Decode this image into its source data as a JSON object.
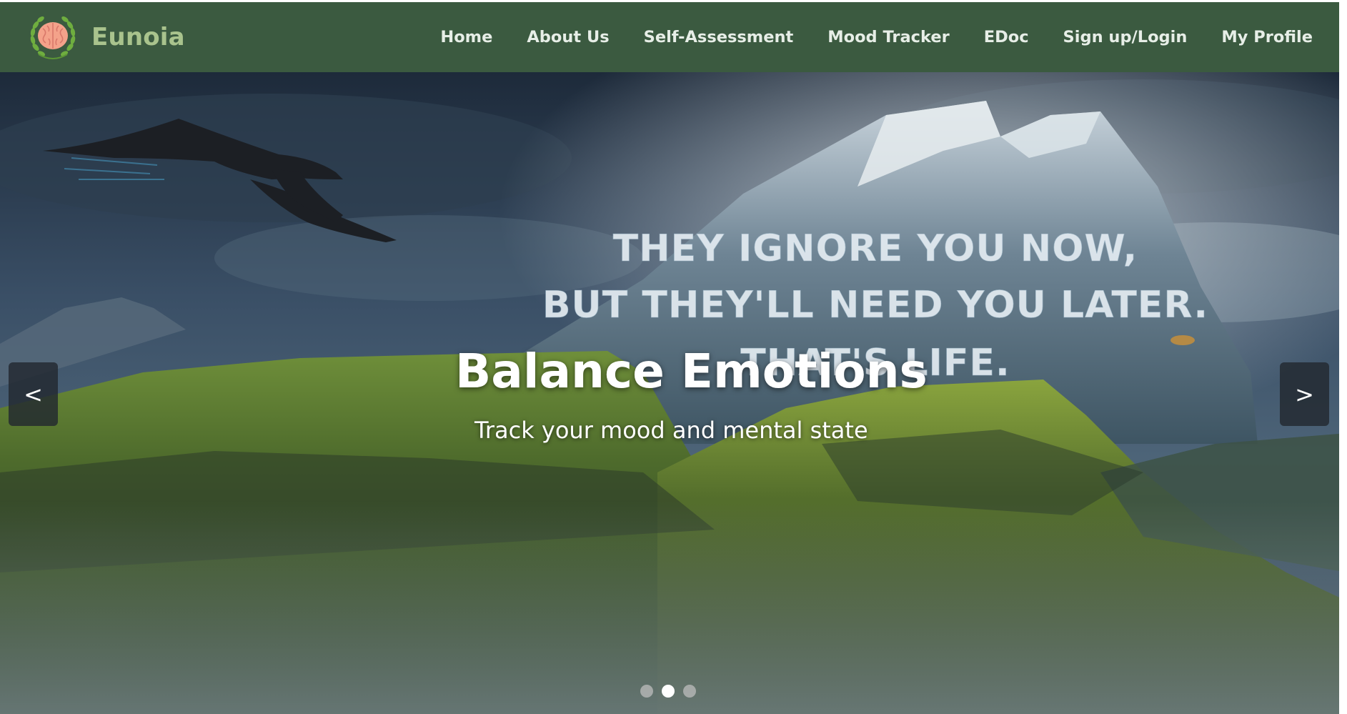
{
  "navbar": {
    "brand_name": "Eunoia",
    "links": [
      {
        "label": "Home"
      },
      {
        "label": "About Us"
      },
      {
        "label": "Self-Assessment"
      },
      {
        "label": "Mood Tracker"
      },
      {
        "label": "EDoc"
      },
      {
        "label": "Sign up/Login"
      },
      {
        "label": "My Profile"
      }
    ],
    "colors": {
      "background": "#3b5a40",
      "brand_text": "#a9c38d",
      "link_text": "#e7eee7"
    }
  },
  "carousel": {
    "slide_image_quote": [
      "THEY IGNORE YOU NOW,",
      "BUT THEY'LL NEED YOU LATER.",
      "THAT'S LIFE."
    ],
    "caption_title": "Balance Emotions",
    "caption_subtitle": "Track your mood and mental state",
    "prev_label": "<",
    "next_label": ">",
    "indicator_count": 3,
    "active_indicator": 2
  }
}
